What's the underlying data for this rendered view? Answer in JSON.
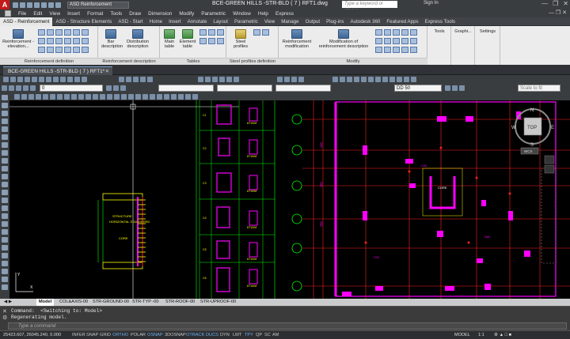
{
  "title_bar": {
    "workspace": "ASD Reinforcement",
    "document_title": "BCE-GREEN HILLS -STR-BLD ( 7 ) RFT1.dwg",
    "search_placeholder": "Type a keyword or phrase",
    "sign_in": "Sign In"
  },
  "menu": [
    "File",
    "Edit",
    "View",
    "Insert",
    "Format",
    "Tools",
    "Draw",
    "Dimension",
    "Modify",
    "Parametric",
    "Window",
    "Help",
    "Express"
  ],
  "ribbon_tabs": [
    "ASD - Reinforcement",
    "ASD - Structure Elements",
    "ASD - Start",
    "Home",
    "Insert",
    "Annotate",
    "Layout",
    "Parametric",
    "View",
    "Manage",
    "Output",
    "Plug-ins",
    "Autodesk 360",
    "Featured Apps",
    "Express Tools"
  ],
  "ribbon": {
    "panels": [
      {
        "label": "Reinforcement definition",
        "buttons": [
          "Reinforcement - elevation..."
        ]
      },
      {
        "label": "Reinforcement description",
        "buttons": [
          "Bar description",
          "Distribution description"
        ]
      },
      {
        "label": "Tables",
        "buttons": [
          "Main table",
          "Element table"
        ]
      },
      {
        "label": "Steel profiles definition",
        "buttons": [
          "Steel profiles"
        ]
      },
      {
        "label": "Modify",
        "buttons": [
          "Reinforcement modification",
          "Modification of reinforcement description"
        ]
      }
    ],
    "extra_tools": [
      "Tools",
      "Graphi...",
      "Settings"
    ]
  },
  "doc_tab": "BCE-GREEN HILLS -STR-BLD ( 7 ) RFT1*",
  "toolbar": {
    "layer_value": "0",
    "dim_style": "DD 50",
    "scale": "Scale to fit"
  },
  "viewcube": {
    "top": "TOP",
    "north": "N",
    "south": "S",
    "east": "E",
    "west": "W",
    "wcs": "WCS"
  },
  "layout_tabs": [
    "Model",
    "COL&AXIS-00",
    "STR-GROUND-00",
    "STR-TYP -00",
    "STR-ROOF-00",
    "STR-UPROOF-00"
  ],
  "command": {
    "history": [
      "Command:  <Switching to: Model>",
      "Regenerating model."
    ],
    "prompt": "Type a command"
  },
  "status": {
    "coords": "25423.607, 26045.240, 0.000",
    "toggles": [
      "INFER",
      "SNAP",
      "GRID",
      "ORTHO",
      "POLAR",
      "OSNAP",
      "3DOSNAP",
      "OTRACK",
      "DUCS",
      "DYN",
      "LWT",
      "TPY",
      "QP",
      "SC",
      "AM"
    ],
    "active_toggles": [
      "ORTHO",
      "OSNAP",
      "OTRACK",
      "DUCS",
      "TPY"
    ],
    "model": "MODEL",
    "scale": "1:1"
  },
  "drawing_labels": {
    "column_ids": [
      "C1",
      "C2",
      "C3",
      "C4",
      "C5",
      "C6"
    ],
    "column_texts": [
      "STRUCTURE",
      "HORIZONTAL STAGGERED",
      "CORE"
    ],
    "bar_tags": [
      "6T10/M",
      "6T10/M",
      "6T10/M",
      "6T10/M",
      "6T10/M",
      "6T10/M"
    ],
    "plan_core": "CORE"
  },
  "colors": {
    "canvas": "#000000",
    "magenta": "#ff00ff",
    "red": "#ff2020",
    "green": "#00ff00",
    "yellow": "#ffff00",
    "cyan": "#00ffff",
    "accent": "#6fb2f0"
  }
}
